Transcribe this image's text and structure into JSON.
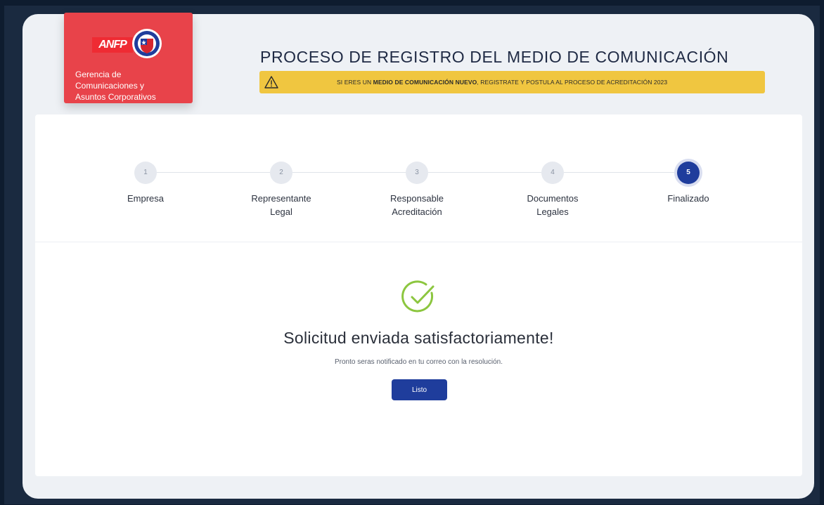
{
  "brand": {
    "logo_text": "ANFP",
    "org_name_lines": [
      "Gerencia de",
      "Comunicaciones y",
      "Asuntos Corporativos"
    ],
    "crest_icon": "chile-federation-crest-icon",
    "card_color": "#e8434a"
  },
  "header": {
    "title": "PROCESO DE REGISTRO DEL MEDIO DE COMUNICACIÓN",
    "alert": {
      "icon": "warning-icon",
      "prefix": "SI ERES UN ",
      "bold": "MEDIO DE COMUNICACIÓN NUEVO",
      "suffix": ", REGISTRATE Y POSTULA AL PROCESO DE ACREDITACIÓN 2023",
      "color": "#f0c640"
    }
  },
  "stepper": {
    "current_step": 5,
    "active_color": "#1f3d9c",
    "steps": [
      {
        "number": "1",
        "label_lines": [
          "Empresa"
        ]
      },
      {
        "number": "2",
        "label_lines": [
          "Representante",
          "Legal"
        ]
      },
      {
        "number": "3",
        "label_lines": [
          "Responsable",
          "Acreditación"
        ]
      },
      {
        "number": "4",
        "label_lines": [
          "Documentos",
          "Legales"
        ]
      },
      {
        "number": "5",
        "label_lines": [
          "Finalizado"
        ]
      }
    ]
  },
  "result": {
    "icon": "check-circle-icon",
    "icon_color": "#8cc63f",
    "title": "Solicitud enviada satisfactoriamente!",
    "subtitle": "Pronto seras notificado en tu correo con la resolución.",
    "button_label": "Listo"
  }
}
